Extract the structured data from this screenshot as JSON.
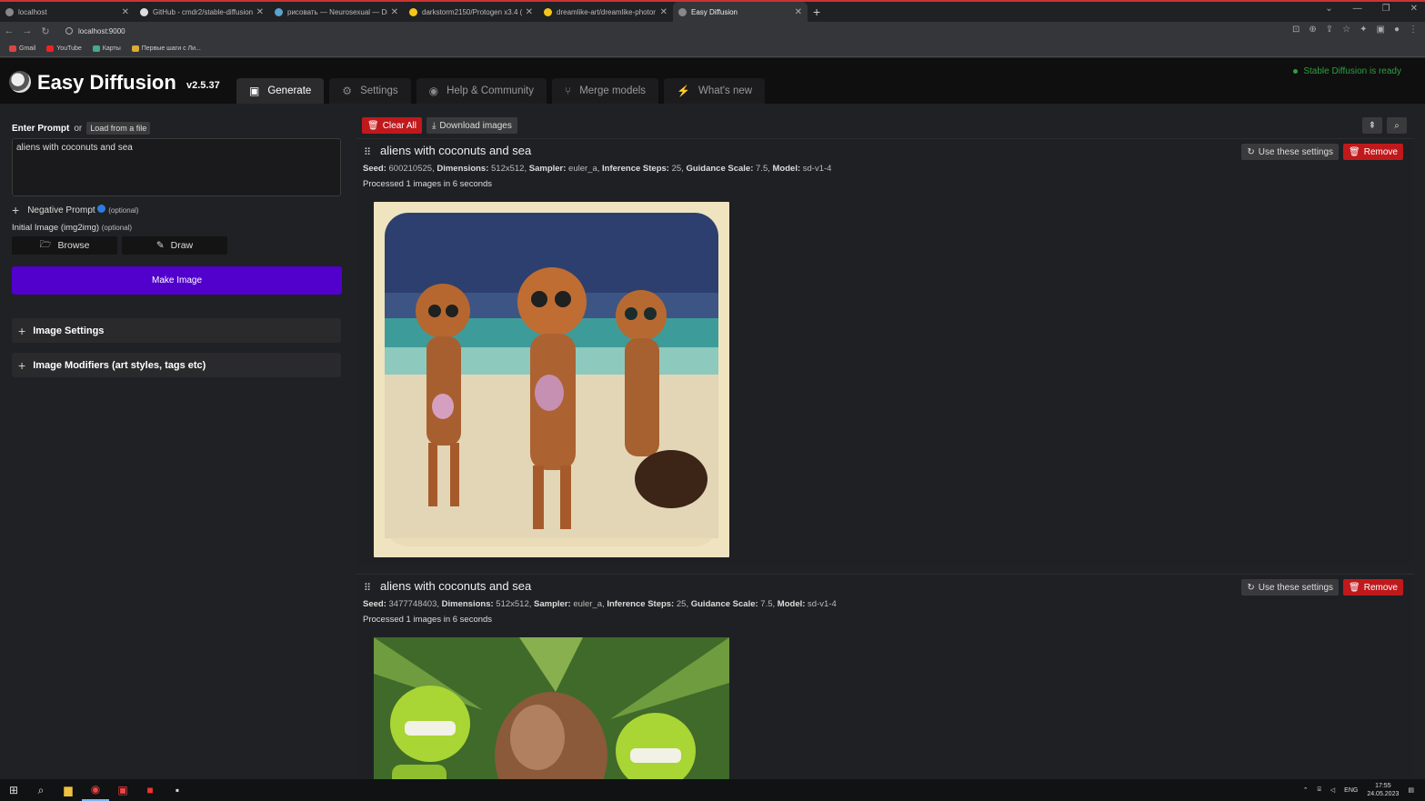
{
  "browser": {
    "tabs": [
      {
        "title": "localhost",
        "active": false,
        "icon": "globe-icon"
      },
      {
        "title": "GitHub - cmdr2/stable-diffusion",
        "active": false,
        "icon": "github-icon"
      },
      {
        "title": "рисовать — Neurosexual — Dr",
        "active": false,
        "icon": "wordpress-icon"
      },
      {
        "title": "darkstorm2150/Protogen x3.4 (",
        "active": false,
        "icon": "huggingface-icon"
      },
      {
        "title": "dreamlike-art/dreamlike-photor",
        "active": false,
        "icon": "huggingface-icon"
      },
      {
        "title": "Easy Diffusion",
        "active": true,
        "icon": "globe-icon"
      }
    ],
    "url": "localhost:9000",
    "bookmarks": [
      "Gmail",
      "YouTube",
      "Карты",
      "Первые шаги с Ли..."
    ]
  },
  "app": {
    "title": "Easy Diffusion",
    "version": "v2.5.37",
    "nav_tabs": [
      {
        "label": "Generate",
        "icon": "image-icon",
        "active": true
      },
      {
        "label": "Settings",
        "icon": "gear-icon",
        "active": false
      },
      {
        "label": "Help & Community",
        "icon": "chat-icon",
        "active": false
      },
      {
        "label": "Merge models",
        "icon": "branch-icon",
        "active": false
      },
      {
        "label": "What's new",
        "icon": "bolt-icon",
        "active": false
      }
    ],
    "status": "Stable Diffusion is ready",
    "status_color": "#2e9e3e"
  },
  "left": {
    "prompt_label": "Enter Prompt",
    "or_text": "or",
    "load_file": "Load from a file",
    "prompt_value": "aliens with coconuts and sea",
    "negative_label": "Negative Prompt",
    "negative_optional": "(optional)",
    "initial_label": "Initial Image (img2img)",
    "initial_optional": "(optional)",
    "browse": "Browse",
    "draw": "Draw",
    "make_image": "Make Image",
    "make_image_color": "#5200cc",
    "image_settings": "Image Settings",
    "image_modifiers": "Image Modifiers (art styles, tags etc)"
  },
  "right": {
    "clear_all": "Clear All",
    "download_images": "Download images",
    "tasks": [
      {
        "title": "aliens with coconuts and sea",
        "seed": "600210525",
        "dimensions": "512x512",
        "sampler": "euler_a",
        "steps": "25",
        "guidance": "7.5",
        "model": "sd-v1-4",
        "processed": "Processed 1 images in 6 seconds",
        "use_settings": "Use these settings",
        "remove": "Remove"
      },
      {
        "title": "aliens with coconuts and sea",
        "seed": "3477748403",
        "dimensions": "512x512",
        "sampler": "euler_a",
        "steps": "25",
        "guidance": "7.5",
        "model": "sd-v1-4",
        "processed": "Processed 1 images in 6 seconds",
        "use_settings": "Use these settings",
        "remove": "Remove"
      }
    ],
    "labels": {
      "seed": "Seed:",
      "dimensions": "Dimensions:",
      "sampler": "Sampler:",
      "steps": "Inference Steps:",
      "guidance": "Guidance Scale:",
      "model": "Model:"
    }
  },
  "taskbar": {
    "lang": "ENG",
    "time": "17:55",
    "date": "24.05.2023"
  }
}
